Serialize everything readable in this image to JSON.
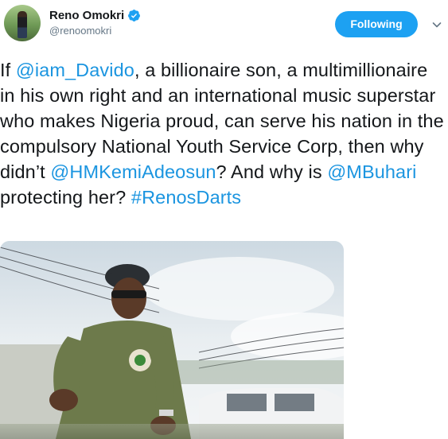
{
  "user": {
    "display_name": "Reno Omokri",
    "handle": "@renoomokri",
    "verified": true
  },
  "actions": {
    "follow_label": "Following",
    "menu_icon": "chevron-down-icon"
  },
  "tweet": {
    "segments": [
      {
        "type": "text",
        "value": "If "
      },
      {
        "type": "mention",
        "value": "@iam_Davido"
      },
      {
        "type": "text",
        "value": ", a billionaire son, a multimillionaire in his own right and an international music superstar who makes Nigeria proud, can serve his nation in the compulsory National Youth Service Corp, then why didn’t "
      },
      {
        "type": "mention",
        "value": "@HMKemiAdeosun"
      },
      {
        "type": "text",
        "value": "? And why is "
      },
      {
        "type": "mention",
        "value": "@MBuhari"
      },
      {
        "type": "text",
        "value": " protecting her? "
      },
      {
        "type": "hashtag",
        "value": "#RenosDarts"
      }
    ]
  },
  "colors": {
    "link": "#1b95e0",
    "button": "#1da1f2",
    "verified": "#1da1f2",
    "secondary_text": "#657786"
  }
}
